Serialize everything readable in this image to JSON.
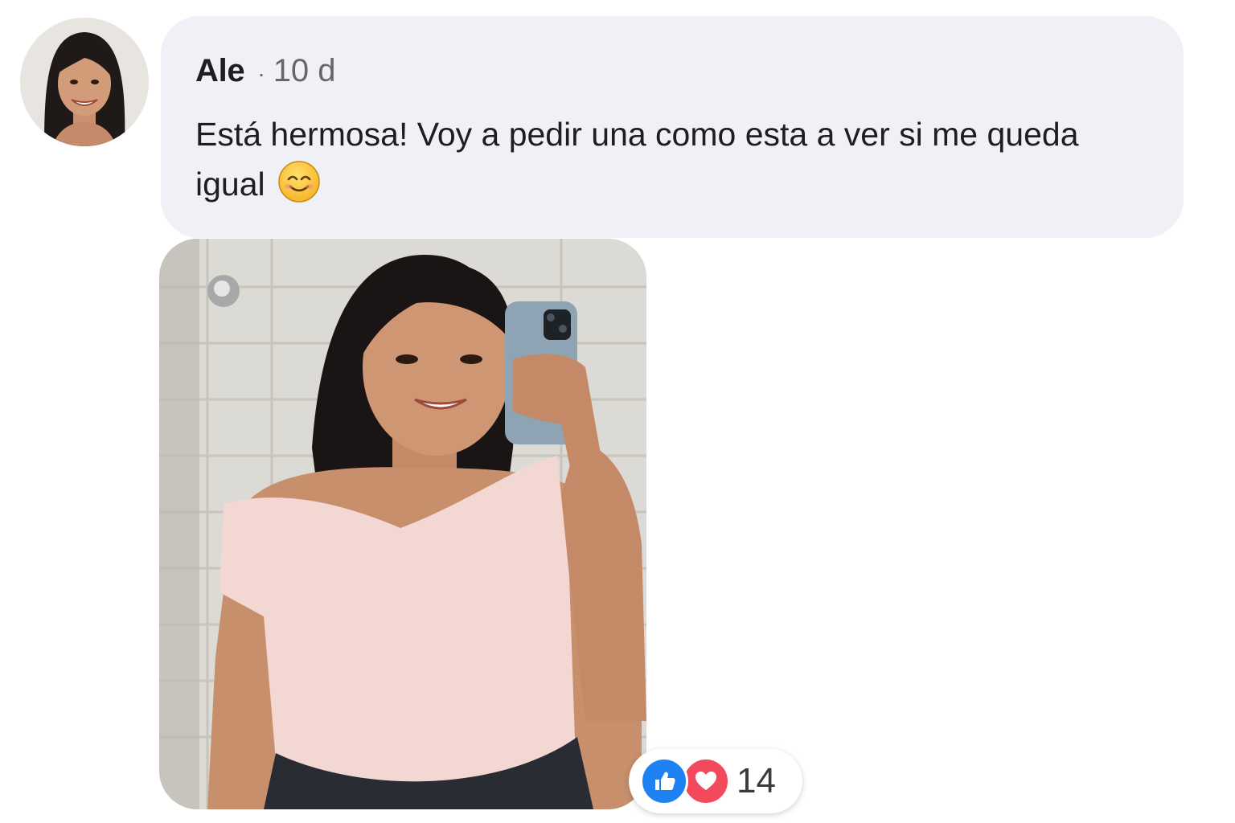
{
  "comment": {
    "author": "Ale",
    "separator": "·",
    "time": "10 d",
    "text": "Está hermosa! Voy a pedir una como esta a ver si me queda igual",
    "emoji": "smiling-face-icon",
    "photo_icon": "selfie-photo",
    "avatar_icon": "profile-photo"
  },
  "reactions": {
    "icons": [
      "like-icon",
      "love-icon"
    ],
    "count": "14",
    "colors": {
      "like": "#1e82f3",
      "love": "#f2495c"
    }
  },
  "colors": {
    "bubble": "#f0f1f6",
    "text": "#1c1e21",
    "meta": "#65676b"
  }
}
